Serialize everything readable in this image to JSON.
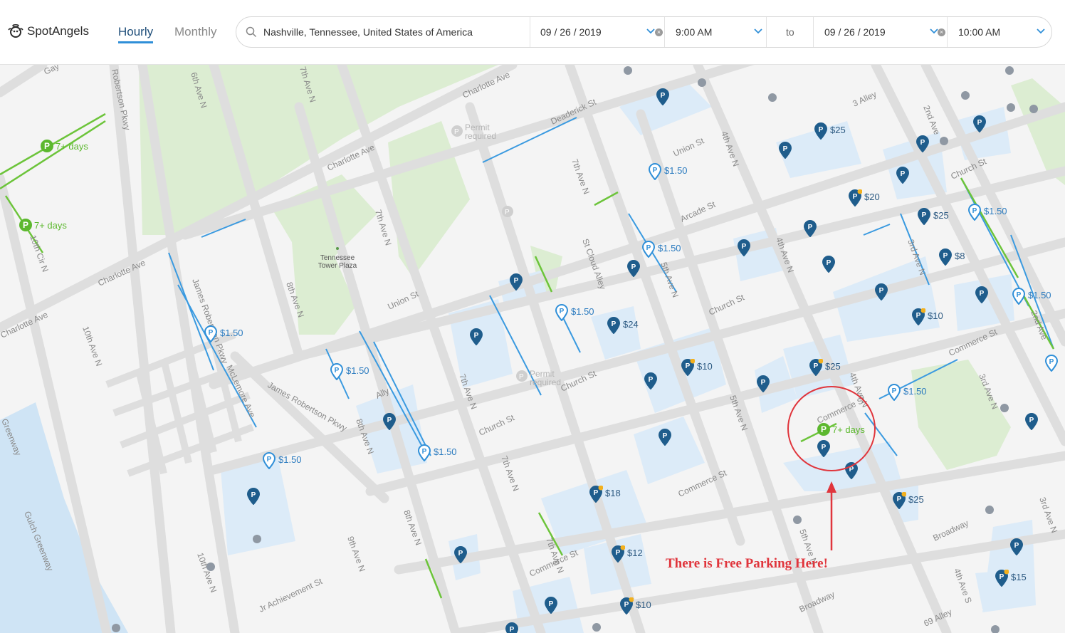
{
  "header": {
    "logo_text": "SpotAngels",
    "tabs": [
      {
        "label": "Hourly",
        "active": true
      },
      {
        "label": "Monthly",
        "active": false
      }
    ],
    "search": {
      "value": "Nashville, Tennessee, United States of America"
    },
    "start_date": "09 / 26 / 2019",
    "start_time": "9:00 AM",
    "to_label": "to",
    "end_date": "09 / 26 / 2019",
    "end_time": "10:00 AM"
  },
  "map": {
    "streets": [
      "Gay",
      "Charlotte Ave",
      "6th Ave N",
      "7th Ave N",
      "Robertson Pkwy",
      "Deaderick St",
      "3 Alley",
      "2nd Ave",
      "Union St",
      "4th Ave N",
      "Church St",
      "Arcade St",
      "St Cloud Alley",
      "5th Ave N",
      "3rd Ave N",
      "8th Ave N",
      "James Robertson Pkwy",
      "McLemore Ave",
      "10th Cir N",
      "10th Ave N",
      "Ally",
      "Commerce St",
      "Broadway",
      "9th Ave N",
      "Jr Achievement St",
      "69 Alley",
      "4th Ave S",
      "Greenway",
      "Gulch Greenway"
    ],
    "poi": [
      "Tennessee",
      "Tower Plaza"
    ],
    "permit": "Permit required",
    "prices": [
      "$25",
      "$1.50",
      "$20",
      "$25",
      "$1.50",
      "$1.50",
      "$8",
      "$1.50",
      "$1.50",
      "$24",
      "$10",
      "$1.50",
      "$10",
      "$25",
      "$1.50",
      "$1.50",
      "$1.50",
      "$1.50",
      "$18",
      "$25",
      "$12",
      "$15",
      "$10"
    ],
    "free_label": "7+ days"
  },
  "annotation": "There is Free Parking Here!",
  "colors": {
    "accent": "#2f8fd8",
    "pin": "#1f5d8c",
    "free": "#5cb82e",
    "annotation": "#e0353c",
    "park": "#dcedd2",
    "lot": "#dbeaf7"
  }
}
